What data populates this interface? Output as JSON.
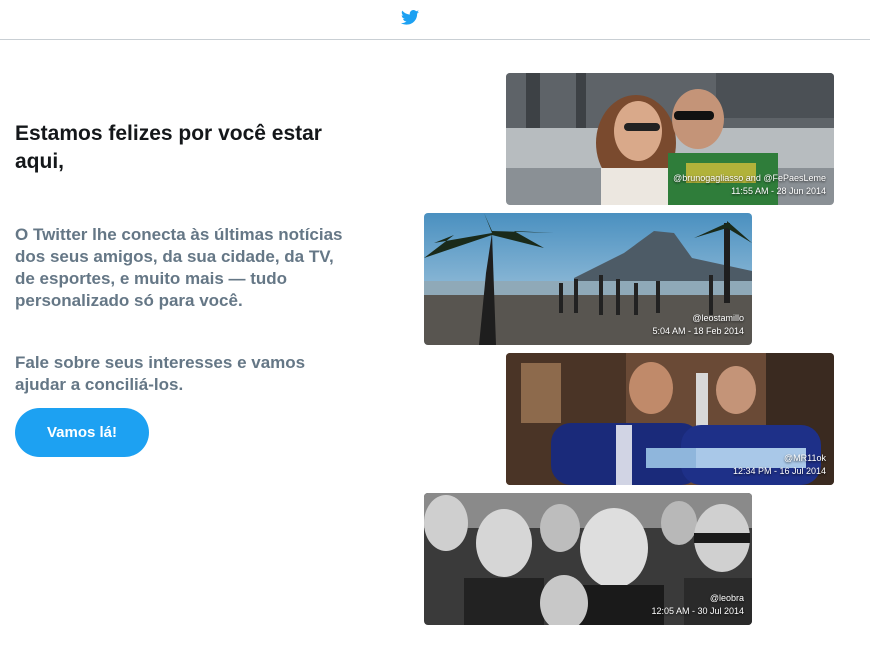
{
  "header": {
    "logo_icon": "twitter-bird-icon",
    "brand_color": "#1da1f2"
  },
  "welcome": {
    "headline": "Estamos felizes por você estar aqui,",
    "paragraph1": "O Twitter lhe conecta às últimas notícias dos seus amigos, da sua cidade, da TV, de esportes, e muito mais — tudo personalizado só para você.",
    "paragraph2": "Fale sobre seus interesses e vamos ajudar a conciliá-los.",
    "cta_label": "Vamos lá!"
  },
  "photos": [
    {
      "handle": "@brunogagliasso and @FePaesLeme",
      "timestamp": "11:55 AM - 28 Jun 2014"
    },
    {
      "handle": "@leostamillo",
      "timestamp": "5:04 AM - 18 Feb 2014"
    },
    {
      "handle": "@MR11ok",
      "timestamp": "12:34 PM - 16 Jul 2014"
    },
    {
      "handle": "@leobra",
      "timestamp": "12:05 AM - 30 Jul 2014"
    }
  ]
}
